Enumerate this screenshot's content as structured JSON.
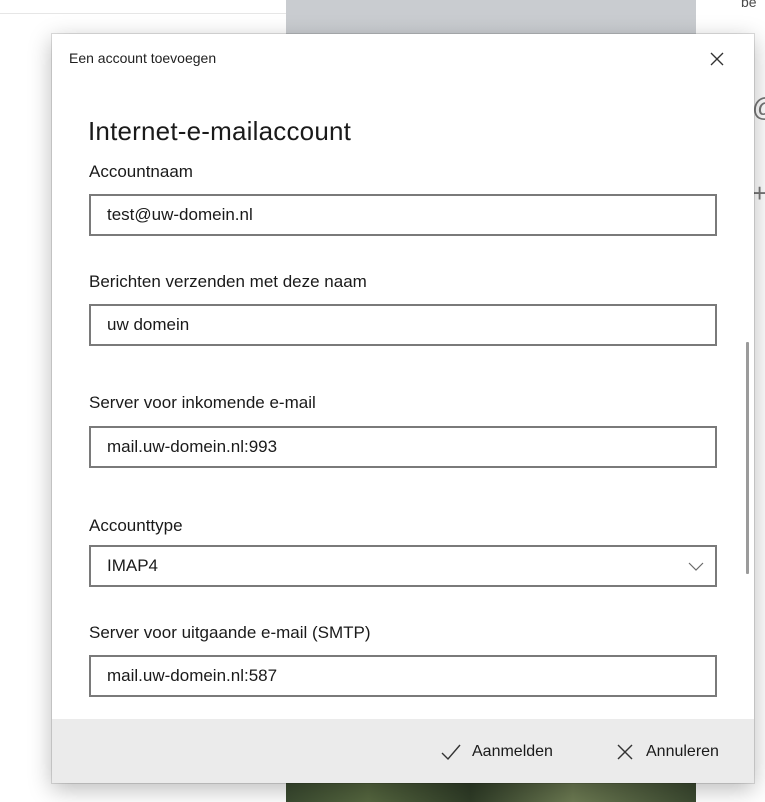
{
  "background": {
    "right_pane_text": "be",
    "right_pane_glyphs": [
      "@",
      "+"
    ]
  },
  "dialog": {
    "title": "Een account toevoegen",
    "heading": "Internet-e-mailaccount",
    "fields": {
      "account_name": {
        "label": "Accountnaam",
        "value": "test@uw-domein.nl"
      },
      "sender_name": {
        "label": "Berichten verzenden met deze naam",
        "value": "uw domein"
      },
      "incoming_server": {
        "label": "Server voor inkomende e-mail",
        "value": "mail.uw-domein.nl:993"
      },
      "account_type": {
        "label": "Accounttype",
        "selected": "IMAP4"
      },
      "outgoing_server": {
        "label": "Server voor uitgaande e-mail (SMTP)",
        "value": "mail.uw-domein.nl:587"
      }
    },
    "footer": {
      "sign_in_label": "Aanmelden",
      "cancel_label": "Annuleren"
    }
  },
  "icons": {
    "close": "close-icon",
    "chevron": "chevron-down-icon",
    "checkmark": "checkmark-icon",
    "cancel": "close-icon"
  },
  "colors": {
    "input_border": "#7a7a7a",
    "footer_background": "#ebebeb",
    "text": "#1a1a1a"
  }
}
